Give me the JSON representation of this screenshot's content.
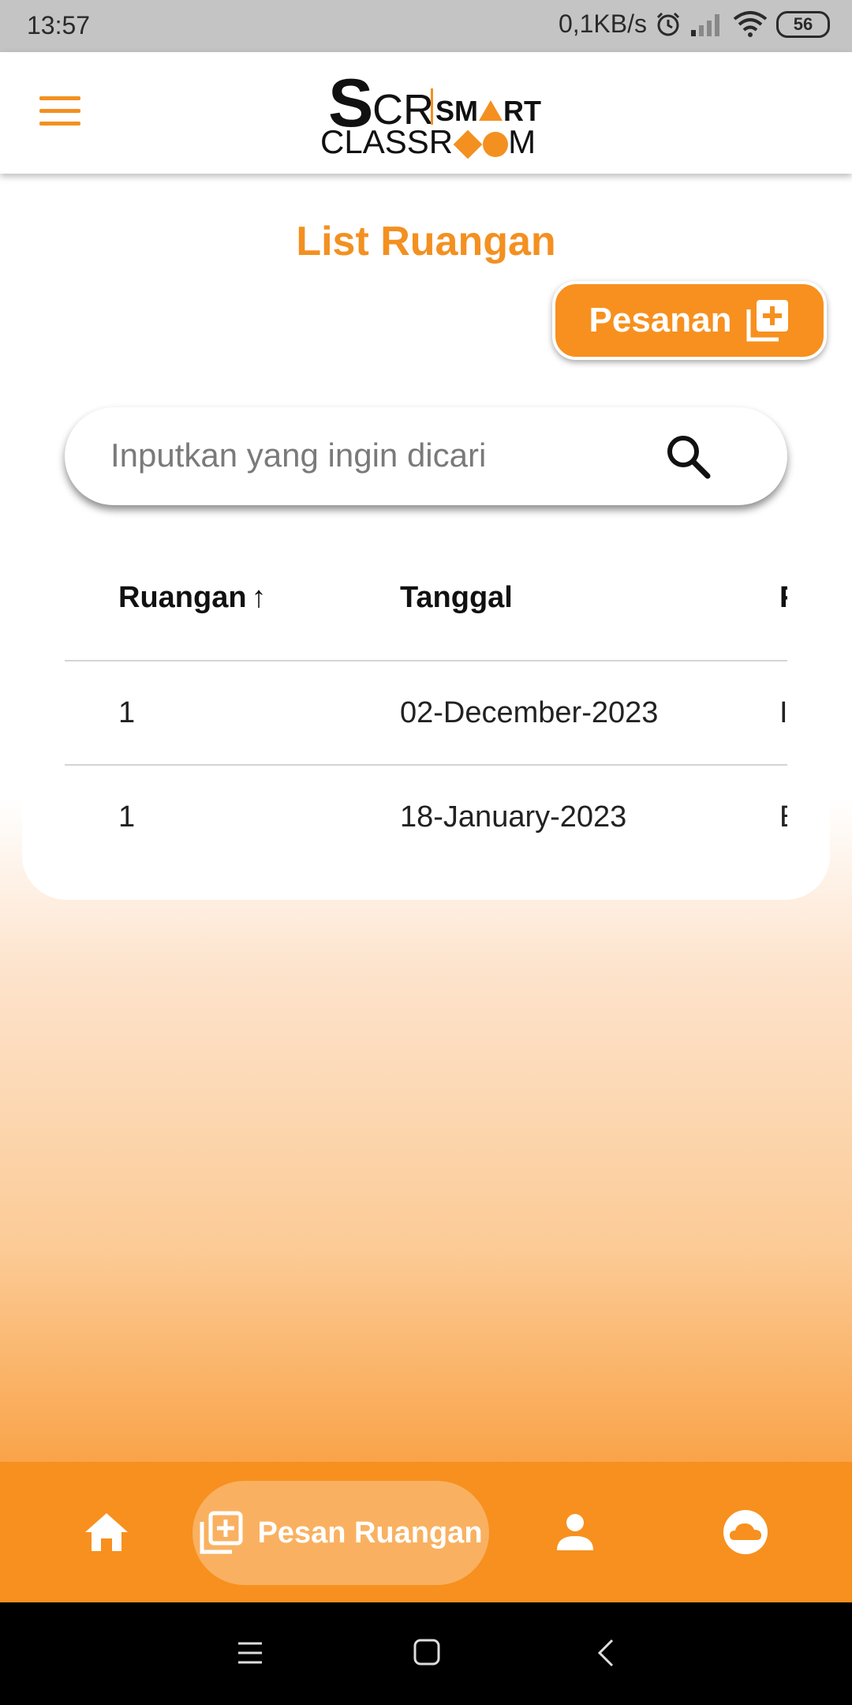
{
  "status_bar": {
    "time": "13:57",
    "net_speed": "0,1KB/s",
    "battery": "56"
  },
  "header": {
    "menu_icon": "hamburger-menu-icon",
    "logo": {
      "big_s": "S",
      "cr": "CR",
      "smart_a": "SM",
      "smart_b": "RT",
      "classroom_a": "CLASSR",
      "classroom_b": "M"
    }
  },
  "page": {
    "title": "List Ruangan",
    "order_button_label": "Pesanan"
  },
  "search": {
    "placeholder": "Inputkan yang ingin dicari",
    "value": ""
  },
  "table": {
    "columns": [
      "Ruangan",
      "Tanggal",
      "F"
    ],
    "sort_indicator": "↑",
    "rows": [
      {
        "ruangan": "1",
        "tanggal": "02-December-2023",
        "third": "I"
      },
      {
        "ruangan": "1",
        "tanggal": "18-January-2023",
        "third": "E"
      }
    ]
  },
  "bottom_nav": {
    "items": [
      {
        "name": "home",
        "icon": "home-icon",
        "label": ""
      },
      {
        "name": "pesan-ruangan",
        "icon": "add-box-icon",
        "label": "Pesan Ruangan",
        "active": true
      },
      {
        "name": "profile",
        "icon": "person-icon",
        "label": ""
      },
      {
        "name": "cloud",
        "icon": "cloud-icon",
        "label": ""
      }
    ]
  },
  "colors": {
    "accent": "#f7901e",
    "title": "#f39020",
    "status_bar": "#c4c4c4"
  }
}
